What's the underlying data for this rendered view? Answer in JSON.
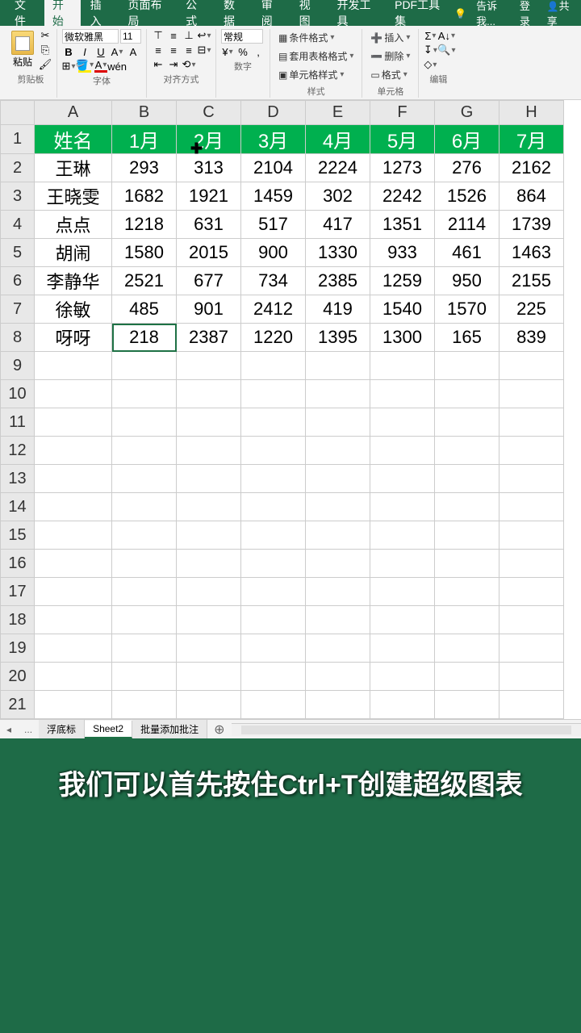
{
  "tabs": {
    "file": "文件",
    "home": "开始",
    "insert": "插入",
    "layout": "页面布局",
    "formula": "公式",
    "data": "数据",
    "review": "审阅",
    "view": "视图",
    "dev": "开发工具",
    "pdf": "PDF工具集",
    "tell": "告诉我...",
    "login": "登录",
    "share": "共享"
  },
  "ribbon": {
    "paste": "粘贴",
    "clipboard": "剪贴板",
    "font_name": "微软雅黑",
    "font_size": "11",
    "font_grp": "字体",
    "align_grp": "对齐方式",
    "num_format": "常规",
    "num_grp": "数字",
    "cond_fmt": "条件格式",
    "tbl_fmt": "套用表格格式",
    "cell_style": "单元格样式",
    "style_grp": "样式",
    "ins": "插入",
    "del": "删除",
    "fmt": "格式",
    "cell_grp": "单元格",
    "edit_grp": "编辑"
  },
  "cols": [
    "A",
    "B",
    "C",
    "D",
    "E",
    "F",
    "G",
    "H"
  ],
  "rows": [
    "1",
    "2",
    "3",
    "4",
    "5",
    "6",
    "7",
    "8",
    "9",
    "10",
    "11",
    "12",
    "13",
    "14",
    "15",
    "16",
    "17",
    "18",
    "19",
    "20",
    "21"
  ],
  "chart_data": {
    "type": "table",
    "headers": [
      "姓名",
      "1月",
      "2月",
      "3月",
      "4月",
      "5月",
      "6月",
      "7月"
    ],
    "data": [
      [
        "王琳",
        "293",
        "313",
        "2104",
        "2224",
        "1273",
        "276",
        "2162"
      ],
      [
        "王晓雯",
        "1682",
        "1921",
        "1459",
        "302",
        "2242",
        "1526",
        "864"
      ],
      [
        "点点",
        "1218",
        "631",
        "517",
        "417",
        "1351",
        "2114",
        "1739"
      ],
      [
        "胡闹",
        "1580",
        "2015",
        "900",
        "1330",
        "933",
        "461",
        "1463"
      ],
      [
        "李静华",
        "2521",
        "677",
        "734",
        "2385",
        "1259",
        "950",
        "2155"
      ],
      [
        "徐敏",
        "485",
        "901",
        "2412",
        "419",
        "1540",
        "1570",
        "225"
      ],
      [
        "呀呀",
        "218",
        "2387",
        "1220",
        "1395",
        "1300",
        "165",
        "839"
      ]
    ]
  },
  "sheets": {
    "nav": "...",
    "s1": "浮底标",
    "s2": "Sheet2",
    "s3": "批量添加批注"
  },
  "caption": "我们可以首先按住Ctrl+T创建超级图表"
}
